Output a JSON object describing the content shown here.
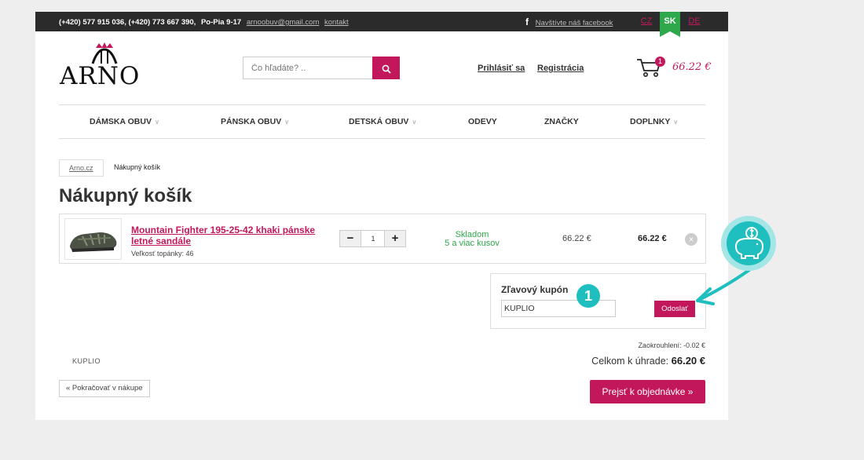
{
  "topbar": {
    "contact": "(+420) 577 915 036, (+420) 773 667 390,",
    "hours": "Po-Pia 9-17",
    "email": "arnoobuv@gmail.com",
    "contact_link": "kontakt",
    "facebook_label": "Navštívte náš facebook",
    "languages": [
      "CZ",
      "SK",
      "DE"
    ]
  },
  "header": {
    "logo_text": "ARNO",
    "search_placeholder": "Čo hľadáte? ..",
    "login": "Prihlásiť sa",
    "register": "Registrácia",
    "cart_count": "1",
    "cart_total": "66.22 €"
  },
  "nav": [
    "DÁMSKA OBUV",
    "PÁNSKA OBUV",
    "DETSKÁ OBUV",
    "ODEVY",
    "ZNAČKY",
    "DOPLNKY"
  ],
  "breadcrumb": {
    "home": "Arno.cz",
    "current": "Nákupný košík"
  },
  "page_title": "Nákupný košík",
  "cart_item": {
    "name": "Mountain Fighter 195-25-42 khaki pánske letné sandále",
    "size": "Veľkosť topánky: 46",
    "quantity": "1",
    "stock_status": "Skladom",
    "stock_detail": "5 a viac kusov",
    "unit_price": "66.22 €",
    "line_total": "66.22 €"
  },
  "coupon": {
    "label": "Zľavový kupón",
    "value": "KUPLIO",
    "submit": "Odoslať"
  },
  "step_marker": "1",
  "kuplio_logo": "KUPLIO",
  "summary": {
    "rounding": "Zaokrouhlení: -0.02 €",
    "total_label": "Celkom k úhrade:",
    "total_value": "66.20 €"
  },
  "buttons": {
    "continue": "« Pokračovať v nákupe",
    "checkout": "Prejsť k objednávke »"
  },
  "colors": {
    "accent": "#c2185b",
    "success": "#2ea84a",
    "teal": "#1fbfbf",
    "topbar": "#2b2b2b"
  }
}
